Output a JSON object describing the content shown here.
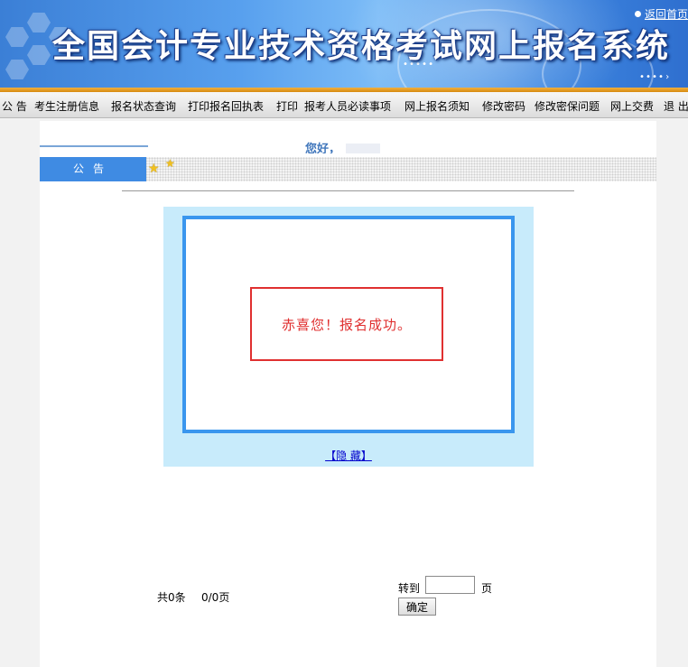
{
  "header": {
    "site_title": "全国会计专业技术资格考试网上报名系统",
    "return_home": "返回首页"
  },
  "nav": {
    "items": [
      {
        "label": "公 告"
      },
      {
        "label": "考生注册信息"
      },
      {
        "label": "报名状态查询"
      },
      {
        "label": "打印报名回执表"
      },
      {
        "label": "打印"
      },
      {
        "label": "报考人员必读事项"
      },
      {
        "label": "网上报名须知"
      },
      {
        "label": "修改密码"
      },
      {
        "label": "修改密保问题"
      },
      {
        "label": "网上交费"
      },
      {
        "label": "退 出"
      }
    ]
  },
  "content": {
    "page_heading": "您好，",
    "notice_tab": "公告",
    "message": "赤喜您！报名成功。",
    "hide_link": "【隐 藏】"
  },
  "pagination": {
    "total": "共0条",
    "pages": "0/0页",
    "goto_label": "转到",
    "goto_value": "",
    "page_unit": "页",
    "confirm_label": "确定"
  },
  "colors": {
    "accent_blue": "#3a96ee",
    "message_red": "#e03030",
    "panel_bg": "#c8ebfb"
  },
  "icons": [
    "star-icon",
    "bullet-icon"
  ]
}
